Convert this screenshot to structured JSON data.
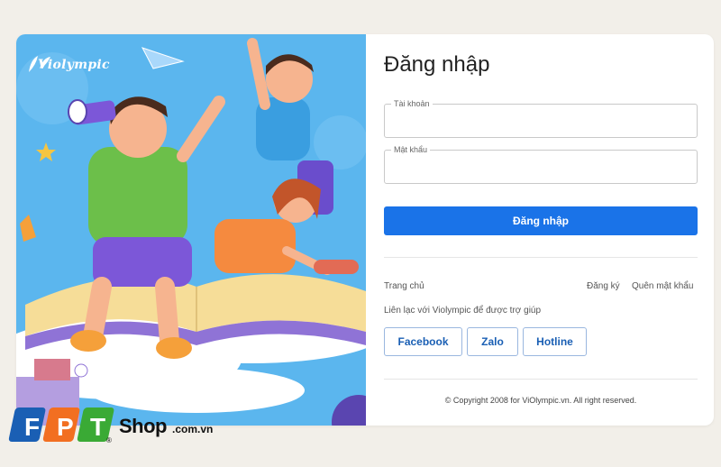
{
  "brand": {
    "logo_text": "Violympic"
  },
  "login": {
    "title": "Đăng nhập",
    "account_label": "Tài khoản",
    "account_value": "",
    "password_label": "Mật khẩu",
    "password_value": "",
    "submit_label": "Đăng nhập"
  },
  "links": {
    "home": "Trang chủ",
    "register": "Đăng ký",
    "forgot_password": "Quên mật khẩu"
  },
  "support": {
    "help_text": "Liên lạc với Violympic để được trợ giúp",
    "buttons": [
      "Facebook",
      "Zalo",
      "Hotline"
    ]
  },
  "footer": {
    "copyright": "© Copyright 2008 for ViOlympic.vn. All right reserved."
  },
  "watermark": {
    "letters": [
      "F",
      "P",
      "T"
    ],
    "shop": "Shop",
    "domain": ".com.vn",
    "reg": "®"
  },
  "colors": {
    "primary": "#1a73e8",
    "hero_bg": "#5bb6ee",
    "page_bg": "#f2efe9",
    "fpt_blue": "#1a5fb4",
    "fpt_orange": "#f26f21",
    "fpt_green": "#3aaa35"
  },
  "icons": [
    "paper-plane-icon",
    "star-icon",
    "leaf-icon",
    "telescope-icon"
  ]
}
